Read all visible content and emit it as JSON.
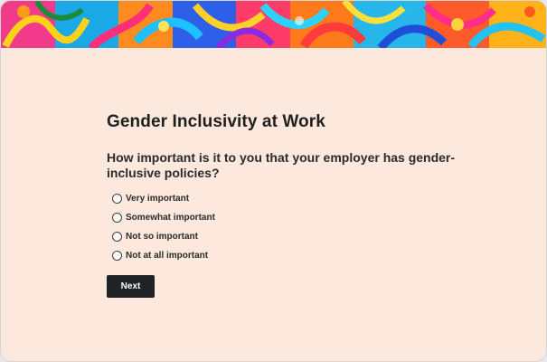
{
  "survey": {
    "title": "Gender Inclusivity at Work",
    "question": "How important is it to you that your employer has gender-inclusive policies?",
    "options": [
      {
        "label": "Very important"
      },
      {
        "label": "Somewhat important"
      },
      {
        "label": "Not so important"
      },
      {
        "label": "Not at all important"
      }
    ],
    "next_label": "Next"
  },
  "colors": {
    "background": "#fce8dd",
    "button": "#1f2326",
    "text": "#1f1f1f"
  }
}
